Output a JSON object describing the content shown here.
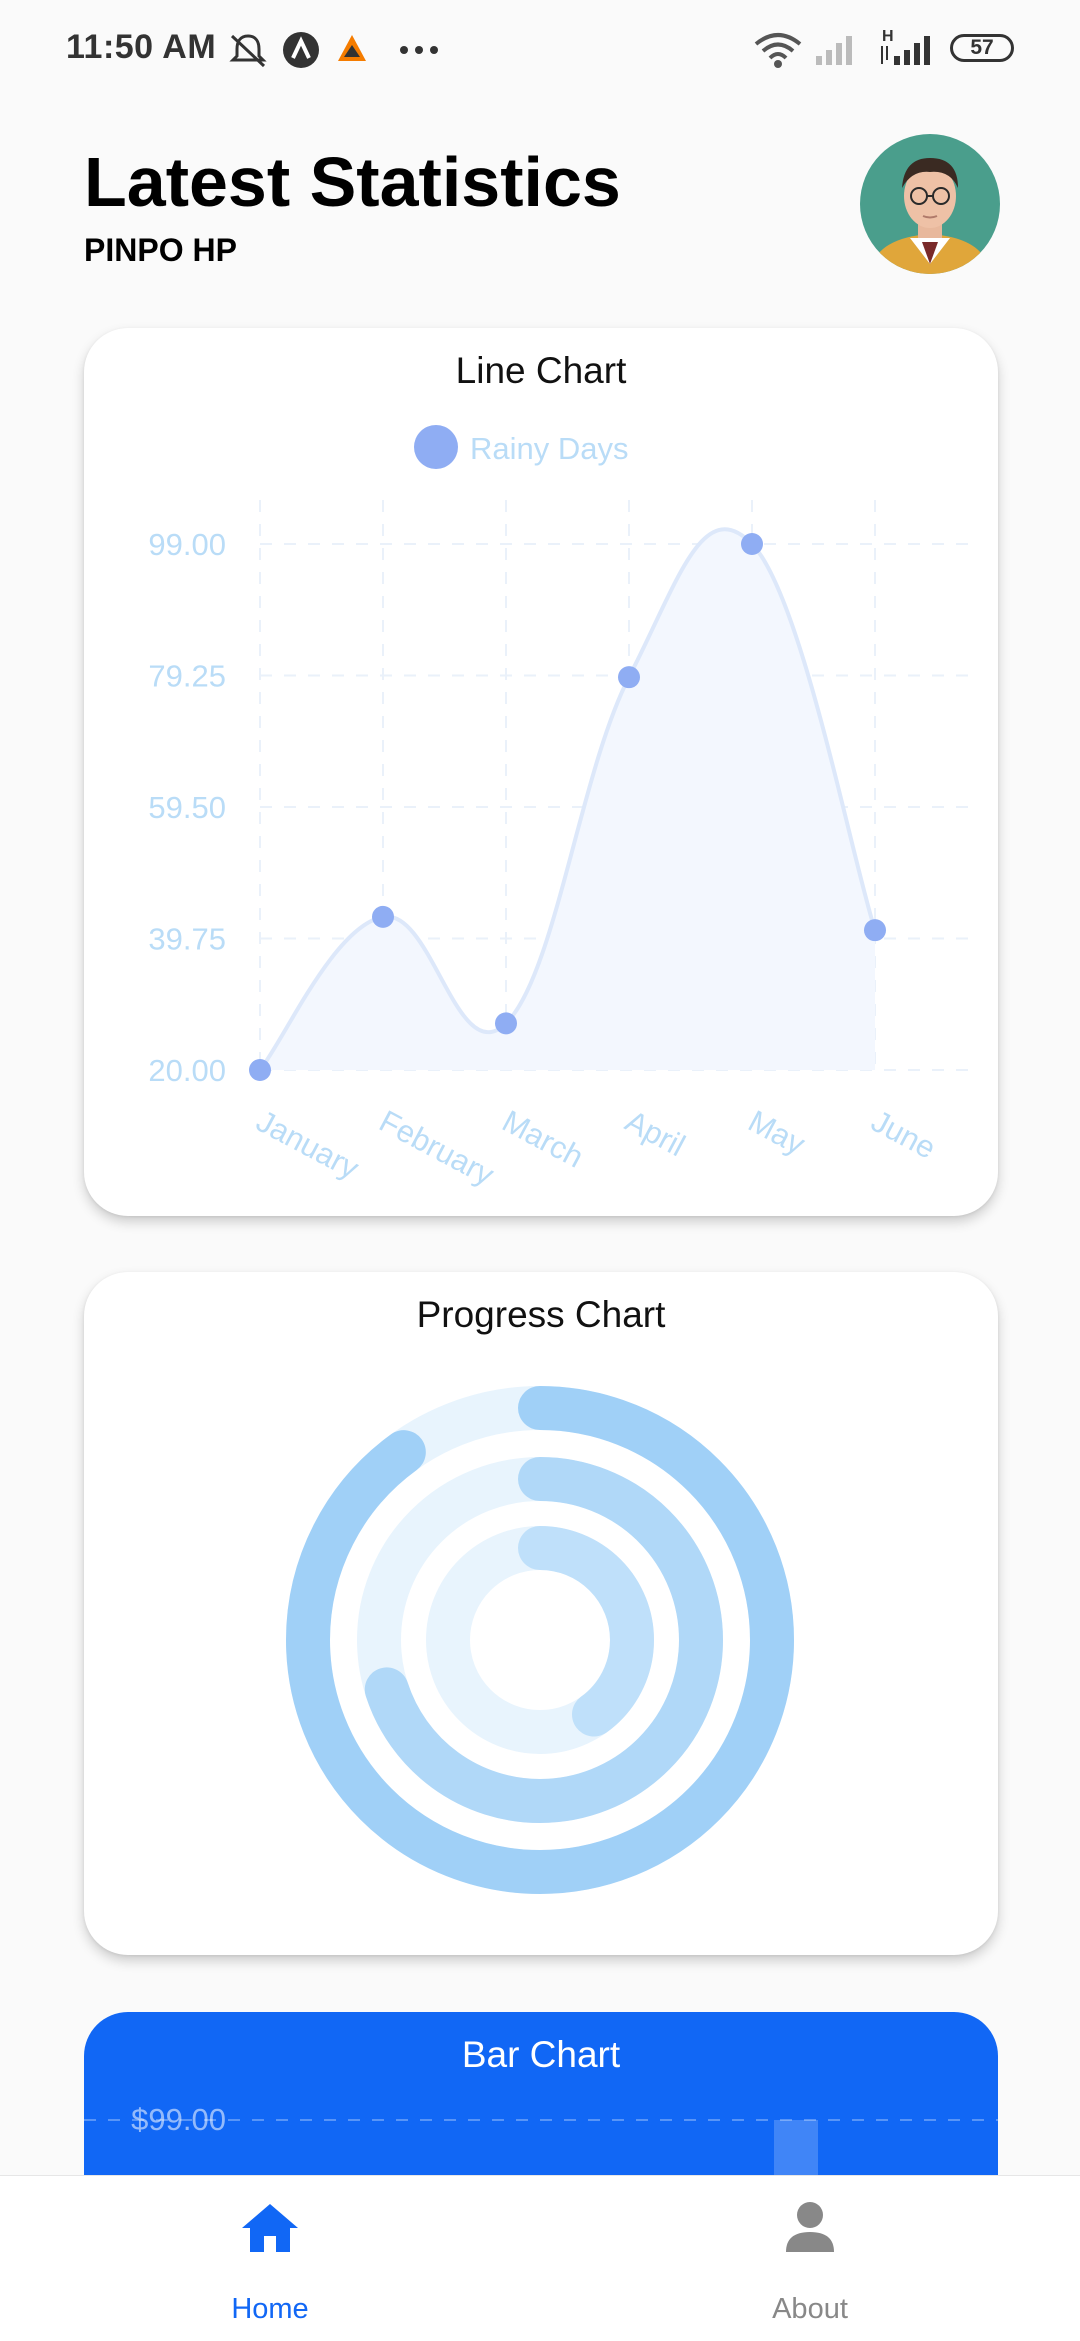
{
  "status_bar": {
    "time": "11:50 AM",
    "battery": "57",
    "network_label": "H"
  },
  "header": {
    "title": "Latest Statistics",
    "subtitle": "PINPO HP"
  },
  "line_card": {
    "title": "Line Chart"
  },
  "progress_card": {
    "title": "Progress Chart"
  },
  "bar_card": {
    "title": "Bar Chart"
  },
  "bottom_nav": {
    "items": [
      {
        "label": "Home",
        "icon": "home-icon",
        "active": true
      },
      {
        "label": "About",
        "icon": "person-icon",
        "active": false
      }
    ]
  },
  "colors": {
    "accent": "#1167f5",
    "line_stroke": "#dde8fa",
    "point": "#8fadf3",
    "axis_label": "#b9dcf7",
    "ring_track": "#e8f4fd",
    "ring_progress": "#a0d0f7"
  },
  "chart_data": [
    {
      "type": "line",
      "title": "Line Chart",
      "legend": "Rainy Days",
      "legend_position": "top",
      "categories": [
        "January",
        "February",
        "March",
        "April",
        "May",
        "June"
      ],
      "series": [
        {
          "name": "Rainy Days",
          "values": [
            20,
            43,
            27,
            79,
            99,
            41
          ]
        }
      ],
      "y_ticks": [
        "20.00",
        "39.75",
        "59.50",
        "79.25",
        "99.00"
      ],
      "ylim": [
        20,
        99
      ],
      "grid": true,
      "smooth": true,
      "filled": true
    },
    {
      "type": "progress",
      "title": "Progress Chart",
      "values": [
        0.9,
        0.7,
        0.4
      ]
    },
    {
      "type": "bar",
      "title": "Bar Chart",
      "y_ticks": [
        "$99.00"
      ]
    }
  ]
}
